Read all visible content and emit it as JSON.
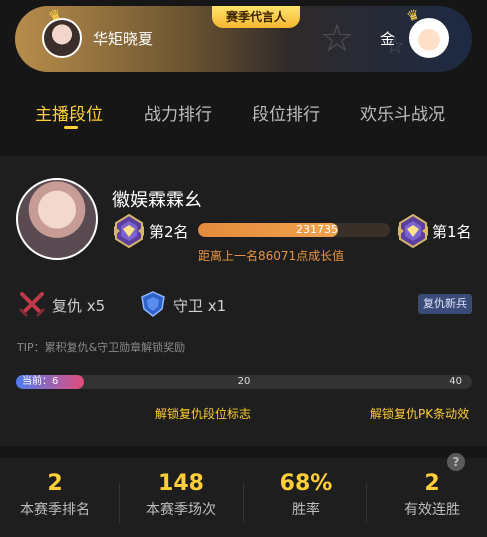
{
  "banner": {
    "tag": "赛季代言人",
    "left_name": "华矩晓夏",
    "right_name": "金"
  },
  "tabs": [
    {
      "label": "主播段位",
      "active": true
    },
    {
      "label": "战力排行",
      "active": false
    },
    {
      "label": "段位排行",
      "active": false
    },
    {
      "label": "欢乐斗战况",
      "active": false
    }
  ],
  "profile": {
    "name": "徽娱霖霖幺",
    "rank_current": "第2名",
    "rank_next": "第1名",
    "score": "231735",
    "score_progress": 0.73,
    "gap_text": "距离上一名86071点成长值"
  },
  "medals": {
    "revenge_label": "复仇",
    "revenge_count": "x5",
    "guard_label": "守卫",
    "guard_count": "x1",
    "badge": "复仇新兵"
  },
  "tip": "TIP：累积复仇&守卫勋章解锁奖励",
  "progress": {
    "current_label": "当前：6",
    "current": 6,
    "mid": "20",
    "max": "40",
    "unlock_mid": "解锁复仇段位标志",
    "unlock_end": "解锁复仇PK条动效"
  },
  "stats": {
    "help": "?",
    "items": [
      {
        "value": "2",
        "label": "本赛季排名"
      },
      {
        "value": "148",
        "label": "本赛季场次"
      },
      {
        "value": "68%",
        "label": "胜率"
      },
      {
        "value": "2",
        "label": "有效连胜"
      }
    ]
  },
  "colors": {
    "accent": "#ffcf3a",
    "orange": "#e9943e",
    "background": "#161616",
    "card": "#1e1e1e"
  }
}
